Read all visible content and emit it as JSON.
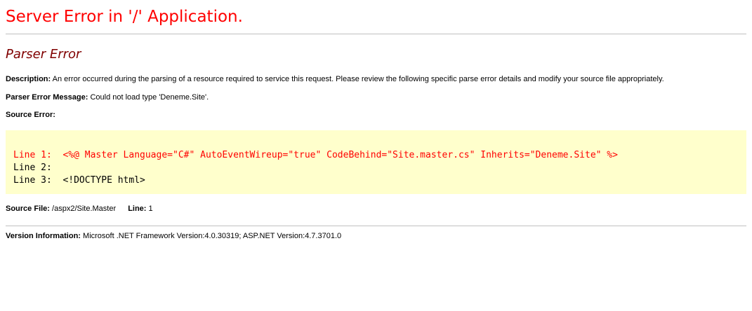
{
  "page": {
    "server_error_title": "Server Error in '/' Application.",
    "parser_error_title": "Parser Error"
  },
  "description": {
    "label": "Description:",
    "text": "An error occurred during the parsing of a resource required to service this request. Please review the following specific parse error details and modify your source file appropriately."
  },
  "parser_message": {
    "label": "Parser Error Message:",
    "text": "Could not load type 'Deneme.Site'."
  },
  "source_error": {
    "label": "Source Error:",
    "lines": [
      {
        "prefix": "Line 1:",
        "code": "<%@ Master Language=\"C#\" AutoEventWireup=\"true\" CodeBehind=\"Site.master.cs\" Inherits=\"Deneme.Site\" %>",
        "highlighted": true
      },
      {
        "prefix": "Line 2:",
        "code": "",
        "highlighted": false
      },
      {
        "prefix": "Line 3:",
        "code": "<!DOCTYPE html>",
        "highlighted": false
      }
    ]
  },
  "source_file": {
    "label": "Source File:",
    "path": "/aspx2/Site.Master",
    "line_label": "Line:",
    "line_value": "1"
  },
  "version": {
    "label": "Version Information:",
    "text": "Microsoft .NET Framework Version:4.0.30319; ASP.NET Version:4.7.3701.0"
  },
  "colors": {
    "title_red": "#ff0000",
    "subtitle_maroon": "#800000",
    "code_background": "#ffffcc",
    "rule_gray": "#c0c0c0"
  }
}
